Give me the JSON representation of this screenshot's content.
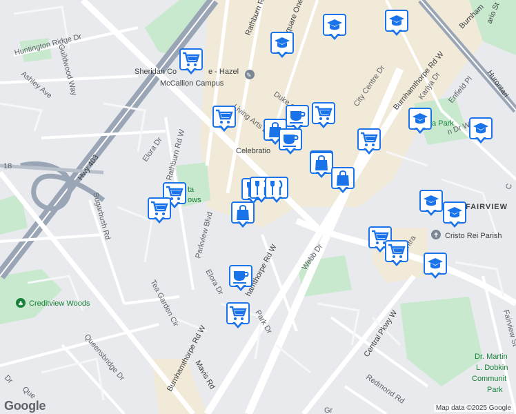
{
  "map": {
    "attribution": "Map data ©2025 Google",
    "logo": "Google"
  },
  "streets": {
    "rathburn_rd": "Rathburn Rd",
    "square_one_dr": "Square One Dr",
    "hurontario_st": "ario St",
    "burnhamthorpe_top": "Burnhamthorpe Rd W",
    "burnhamthorpe_right_top": "Burnham",
    "hurontario_right": "Hurontari",
    "huntington_ridge_dr": "Huntington Ridge Dr",
    "guildwood_way": "Guildwood Way",
    "ashley_ave": "Ashley Ave",
    "duke_of_york": "Duke of Yo",
    "living_arts_dr": "Living Arts Dr",
    "city_centre_dr": "City Centre Dr",
    "kariya_dr": "Kariya Dr",
    "enfield_pl": "Enfield Pl",
    "hwy_403": "Hwy 403",
    "rathburn_rd_w": "Rathburn Rd W",
    "elora_dr_top": "Elora Dr",
    "celebration": "Celebratio",
    "confederation": "n Dr W",
    "fairview": "FAIRVIEW",
    "cristo_rei": "Cristo Rei Parish",
    "hwy_18": "18",
    "sugarbush_rd": "Sugarbush Rd",
    "parkview_blvd": "Parkview Blvd",
    "burnhamthorpe_mid": "hamthorpe Rd W",
    "webb_dr": "Webb Dr",
    "elora_dr_mid": "Elora Dr",
    "tea_garden_cir": "Tea Garden Cir",
    "creditview_woods": "Creditview Woods",
    "queensbridge_dr": "Queensbridge Dr",
    "burnhamthorpe_low": "Burnhamthorpe Rd W",
    "park_dr": "Park Dr",
    "central_pkwy_w": "Central Pkwy W",
    "redmond_rd": "Redmond Rd",
    "mavis_rd": "Mavis Rd",
    "fairview_st": "Fairview St",
    "gr": "Gr",
    "que": "Que",
    "dr_bottom": "Dr",
    "c_right": "C",
    "sheridan_line1": "Sheridan Co",
    "sheridan_line2": "e - Hazel",
    "sheridan_line3": "McCallion Campus",
    "park_label": "a Park",
    "meadows_label": "ta",
    "meadows_label2": "ows",
    "dobkin_line1": "Dr. Martin",
    "dobkin_line2": "L. Dobkin",
    "dobkin_line3": "Communit",
    "dobkin_line4": "Park",
    "central_label": "ntra"
  },
  "pins": [
    {
      "type": "school",
      "name": "school-pin"
    },
    {
      "type": "school",
      "name": "school-pin"
    },
    {
      "type": "school",
      "name": "school-pin"
    },
    {
      "type": "grocery",
      "name": "grocery-pin"
    },
    {
      "type": "grocery",
      "name": "grocery-pin"
    },
    {
      "type": "cafe",
      "name": "cafe-pin"
    },
    {
      "type": "grocery",
      "name": "grocery-pin"
    },
    {
      "type": "shopping",
      "name": "shopping-pin"
    },
    {
      "type": "cafe",
      "name": "cafe-pin"
    },
    {
      "type": "shopping",
      "name": "shopping-pin"
    },
    {
      "type": "grocery",
      "name": "grocery-pin"
    },
    {
      "type": "school",
      "name": "school-pin"
    },
    {
      "type": "school",
      "name": "school-pin"
    },
    {
      "type": "shopping",
      "name": "shopping-pin"
    },
    {
      "type": "shopping",
      "name": "shopping-pin"
    },
    {
      "type": "restaurant",
      "name": "restaurant-pin"
    },
    {
      "type": "restaurant",
      "name": "restaurant-pin"
    },
    {
      "type": "restaurant",
      "name": "restaurant-pin"
    },
    {
      "type": "grocery",
      "name": "grocery-pin"
    },
    {
      "type": "grocery",
      "name": "grocery-pin"
    },
    {
      "type": "shopping",
      "name": "shopping-pin"
    },
    {
      "type": "school",
      "name": "school-pin"
    },
    {
      "type": "school",
      "name": "school-pin"
    },
    {
      "type": "grocery",
      "name": "grocery-pin"
    },
    {
      "type": "grocery",
      "name": "grocery-pin"
    },
    {
      "type": "school",
      "name": "school-pin"
    },
    {
      "type": "cafe",
      "name": "cafe-pin"
    },
    {
      "type": "grocery",
      "name": "grocery-pin"
    }
  ],
  "colors": {
    "pin_border": "#1a73e8",
    "pin_icon": "#1a73e8",
    "park": "#c9e9cf",
    "commercial": "#f2ead8",
    "highway": "#9aa5b5",
    "road": "#ffffff"
  }
}
